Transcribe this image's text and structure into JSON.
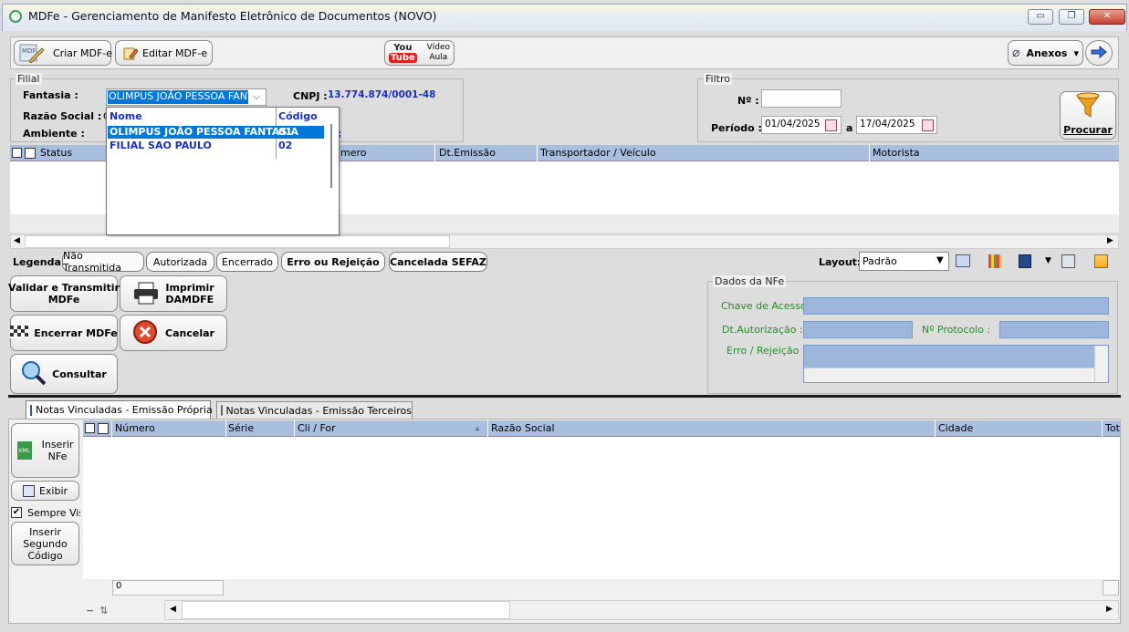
{
  "window": {
    "title": "MDFe - Gerenciamento de Manifesto Eletrônico de Documentos (NOVO)",
    "minimize": "▭",
    "maximize": "❐",
    "close": "✕"
  },
  "toolbar": {
    "criar": "Criar MDF-e",
    "editar": "Editar MDF-e",
    "youtube_top": "You",
    "youtube_bottom": "Tube",
    "video_line1": "Vídeo",
    "video_line2": "Aula",
    "anexos": "Anexos",
    "anexos_arrow": "▾"
  },
  "filial": {
    "title": "Filial",
    "fantasia_label": "Fantasia :",
    "fantasia_value": "OLIMPUS JOÃO PESSOA FANT",
    "cnpj_label": "CNPJ :",
    "cnpj_value": "13.774.874/0001-48",
    "razao_label": "Razão Social :",
    "razao_partial": "C",
    "ambiente_label": "Ambiente :",
    "ambiente_partial": "",
    "tail": ";"
  },
  "dropdown": {
    "col_nome": "Nome",
    "col_codigo": "Código",
    "rows": [
      {
        "nome": "OLIMPUS JOÃO PESSOA FANTASIA",
        "codigo": "01"
      },
      {
        "nome": "FILIAL SAO PAULO",
        "codigo": "02"
      }
    ]
  },
  "filtro": {
    "title": "Filtro",
    "numero_label": "Nº :",
    "numero_value": "",
    "periodo_label": "Período :",
    "date_from": "01/04/2025",
    "a_label": "a",
    "date_to": "17/04/2025",
    "procurar": "Procurar"
  },
  "main_grid": {
    "columns": [
      "Status",
      "mero",
      "Dt.Emissão",
      "Transportador / Veículo",
      "Motorista"
    ]
  },
  "legend": {
    "label": "Legenda:",
    "items": [
      "Não Transmitida",
      "Autorizada",
      "Encerrado",
      "Erro ou Rejeição",
      "Cancelada SEFAZ"
    ]
  },
  "layout": {
    "label": "Layout:",
    "value": "Padrão"
  },
  "actions": {
    "validar_l1": "Validar e Transmitir",
    "validar_l2": "MDFe",
    "imprimir_l1": "Imprimir",
    "imprimir_l2": "DAMDFE",
    "encerrar": "Encerrar MDFe",
    "cancelar": "Cancelar",
    "consultar": "Consultar"
  },
  "dados_nfe": {
    "title": "Dados da NFe",
    "chave_label": "Chave de Acesso",
    "dt_aut_label": "Dt.Autorização :",
    "protocolo_label": "Nº Protocolo :",
    "erro_label": "Erro / Rejeição :"
  },
  "tabs": {
    "propria": "Notas Vinculadas - Emissão Própria",
    "terceiros": "Notas Vinculadas - Emissão Terceiros"
  },
  "notes_grid": {
    "columns": [
      "Número",
      "Série",
      "Cli / For",
      "Razão Social",
      "Cidade",
      "Tot"
    ],
    "footer_count": "0"
  },
  "side": {
    "inserir_l1": "Inserir",
    "inserir_l2": "NFe",
    "xml": "XML",
    "exibir": "Exibir",
    "sempre_vis": "Sempre Vis",
    "inserir_seg_l1": "Inserir",
    "inserir_seg_l2": "Segundo",
    "inserir_seg_l3": "Código"
  },
  "colors": {
    "grid_header": "#a9bfe0",
    "field_fill": "#9db6db",
    "selection": "#0078d7",
    "link_blue": "#1a2fbf",
    "label_green": "#2a8a2a"
  }
}
